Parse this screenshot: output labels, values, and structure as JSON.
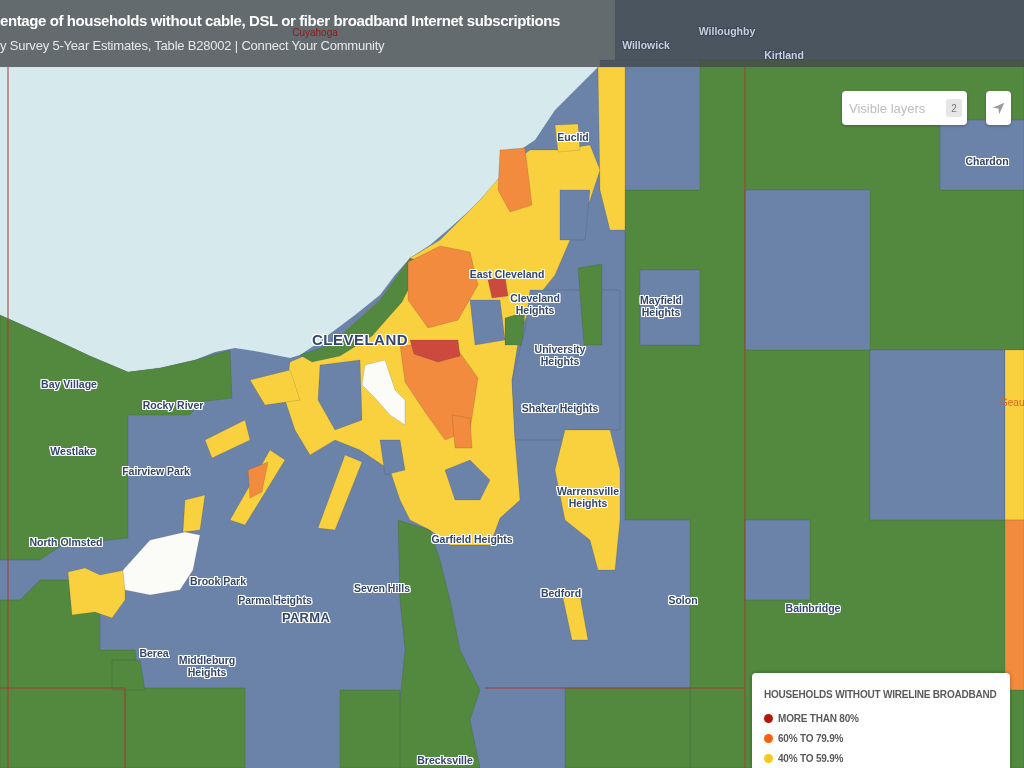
{
  "header": {
    "title": "entage of households without cable, DSL or fiber broadband Internet subscriptions",
    "subtitle": "y Survey 5-Year Estimates, Table B28002 | Connect Your Community"
  },
  "layers_control": {
    "placeholder": "Visible layers",
    "count": "2"
  },
  "map": {
    "labels": [
      {
        "text": "Cuyahoga",
        "kind": "county",
        "color": "#8b1a1a"
      },
      {
        "text": "Willowick",
        "kind": "place"
      },
      {
        "text": "Willoughby",
        "kind": "place"
      },
      {
        "text": "Kirtland",
        "kind": "place"
      },
      {
        "text": "Euclid",
        "kind": "place"
      },
      {
        "text": "Chardon",
        "kind": "place"
      },
      {
        "text": "East Cleveland",
        "kind": "place"
      },
      {
        "text": "Cleveland Heights",
        "kind": "place"
      },
      {
        "text": "Mayfield Heights",
        "kind": "place"
      },
      {
        "text": "CLEVELAND",
        "kind": "big-city"
      },
      {
        "text": "University Heights",
        "kind": "place"
      },
      {
        "text": "Bay Village",
        "kind": "place"
      },
      {
        "text": "Rocky River",
        "kind": "place"
      },
      {
        "text": "Geau",
        "kind": "county",
        "color": "#d9661f"
      },
      {
        "text": "Shaker Heights",
        "kind": "place"
      },
      {
        "text": "Westlake",
        "kind": "place"
      },
      {
        "text": "Fairview Park",
        "kind": "place"
      },
      {
        "text": "Warrensville Heights",
        "kind": "place"
      },
      {
        "text": "North Olmsted",
        "kind": "place"
      },
      {
        "text": "Garfield Heights",
        "kind": "place"
      },
      {
        "text": "Brook Park",
        "kind": "place"
      },
      {
        "text": "Seven Hills",
        "kind": "place"
      },
      {
        "text": "Bedford",
        "kind": "place"
      },
      {
        "text": "Parma Heights",
        "kind": "place"
      },
      {
        "text": "Solon",
        "kind": "place"
      },
      {
        "text": "Bainbridge",
        "kind": "place"
      },
      {
        "text": "PARMA",
        "kind": "city"
      },
      {
        "text": "Berea",
        "kind": "place"
      },
      {
        "text": "Middleburg Heights",
        "kind": "place"
      },
      {
        "text": "Brecksville",
        "kind": "place"
      }
    ]
  },
  "legend": {
    "title": "HOUSEHOLDS WITHOUT WIRELINE BROADBAND",
    "items": [
      {
        "label": "MORE THAN 80%",
        "color": "#b3160c"
      },
      {
        "label": "60% TO 79.9%",
        "color": "#f5620f"
      },
      {
        "label": "40% TO 59.9%",
        "color": "#f8c81c"
      }
    ]
  }
}
